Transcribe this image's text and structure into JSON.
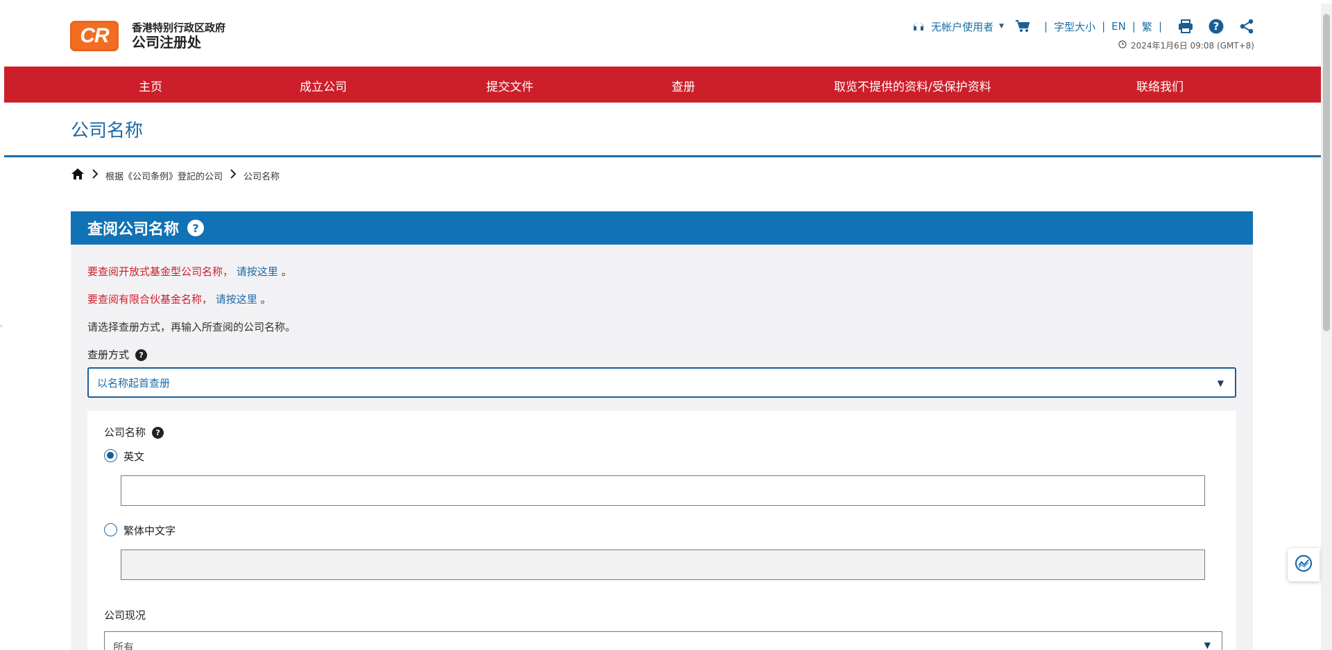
{
  "header": {
    "logo_mark": "CR",
    "logo_line1": "香港特别行政区政府",
    "logo_line2": "公司注册处",
    "user_label": "无帐户使用者",
    "font_size_label": "字型大小",
    "lang_en": "EN",
    "lang_tc": "繁",
    "datetime": "2024年1月6日 09:08 (GMT+8)"
  },
  "nav": {
    "items": [
      {
        "label": "主页"
      },
      {
        "label": "成立公司"
      },
      {
        "label": "提交文件"
      },
      {
        "label": "查册"
      },
      {
        "label": "取览不提供的资料/受保护资料"
      },
      {
        "label": "联络我们"
      }
    ]
  },
  "page": {
    "title": "公司名称",
    "breadcrumb": {
      "level1": "根据《公司条例》登記的公司",
      "level2": "公司名称"
    }
  },
  "panel": {
    "heading": "查阅公司名称",
    "help": "?",
    "ofc_text": "要查阅开放式基金型公司名称，",
    "ofc_link": "请按这里",
    "ofc_end": "。",
    "lpf_text": "要查阅有限合伙基金名称，",
    "lpf_link": "请按这里",
    "lpf_end": "。",
    "instruction": "请选择查册方式，再输入所查阅的公司名称。",
    "search_method_label": "查册方式",
    "search_method_value": "以名称起首查册",
    "company_name_label": "公司名称",
    "option_english": "英文",
    "option_chinese": "繁体中文字",
    "english_value": "",
    "chinese_value": "",
    "status_label": "公司现况",
    "status_value": "所有"
  },
  "colors": {
    "nav_red": "#cc1f2a",
    "panel_blue": "#1172b5",
    "link_blue": "#1b6aa5",
    "alert_red": "#d01c2a",
    "logo_orange": "#f26d21"
  }
}
